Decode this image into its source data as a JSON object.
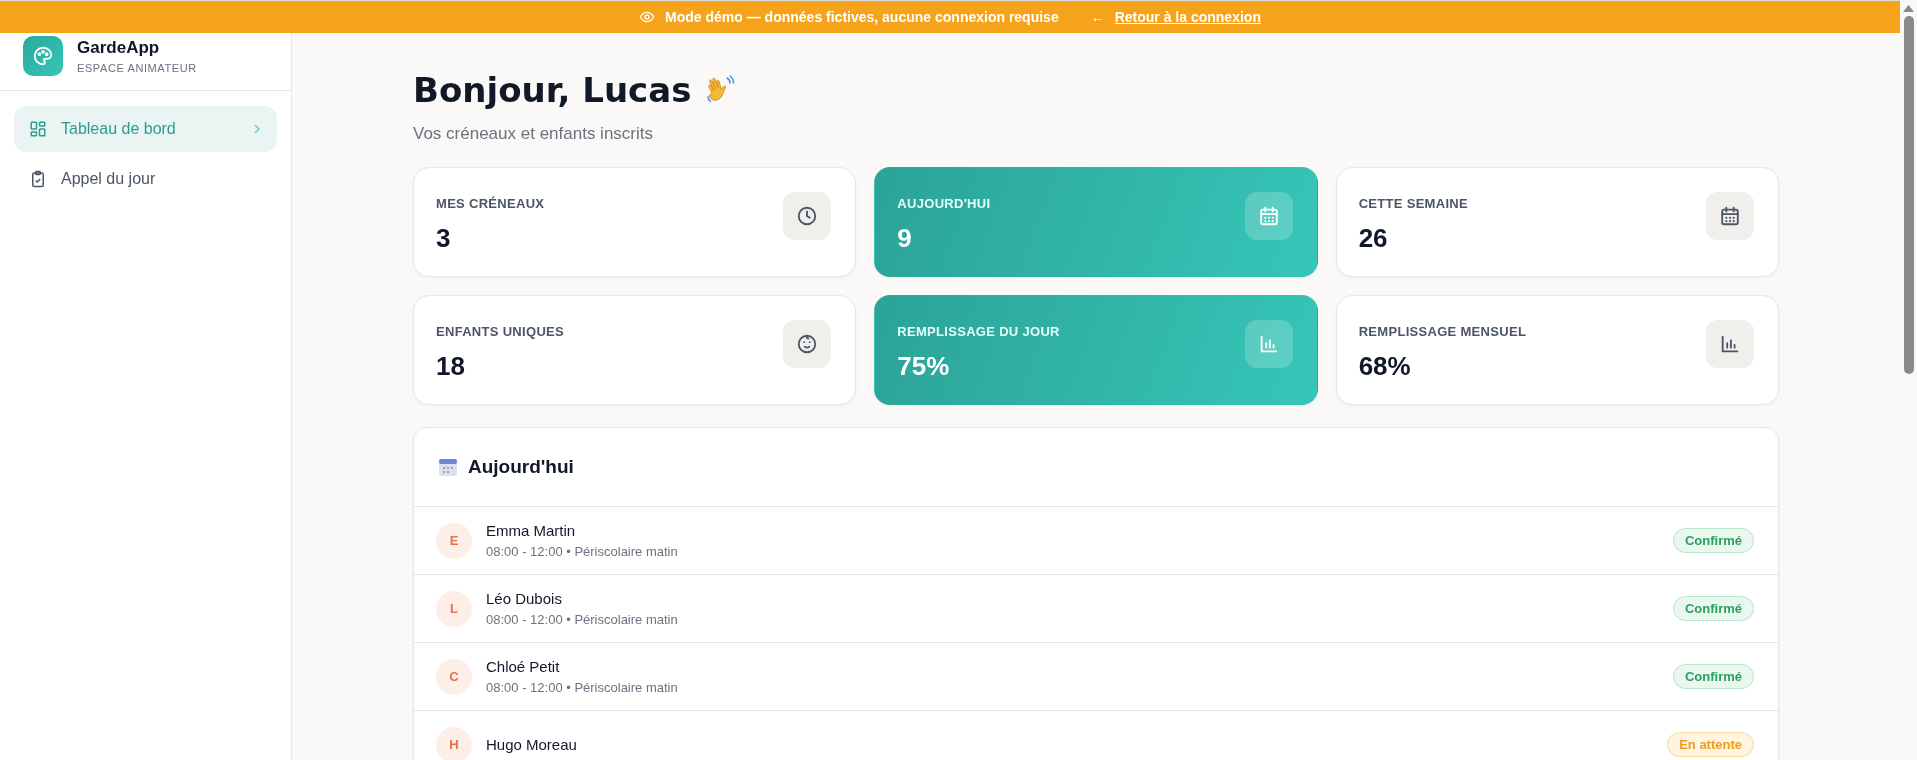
{
  "banner": {
    "message": "Mode démo — données fictives, aucune connexion requise",
    "arrow": "←",
    "link": "Retour à la connexion"
  },
  "sidebar": {
    "app_name": "GardeApp",
    "subtitle": "ESPACE ANIMATEUR",
    "items": [
      {
        "label": "Tableau de bord",
        "selected": true
      },
      {
        "label": "Appel du jour",
        "selected": false
      }
    ]
  },
  "header": {
    "title": "Bonjour, Lucas",
    "subtitle": "Vos créneaux et enfants inscrits"
  },
  "stats": [
    {
      "label": "MES CRÉNEAUX",
      "value": "3",
      "highlighted": false
    },
    {
      "label": "AUJOURD'HUI",
      "value": "9",
      "highlighted": true
    },
    {
      "label": "CETTE SEMAINE",
      "value": "26",
      "highlighted": false
    },
    {
      "label": "ENFANTS UNIQUES",
      "value": "18",
      "highlighted": false
    },
    {
      "label": "REMPLISSAGE DU JOUR",
      "value": "75%",
      "highlighted": true
    },
    {
      "label": "REMPLISSAGE MENSUEL",
      "value": "68%",
      "highlighted": false
    }
  ],
  "today": {
    "title": "Aujourd'hui",
    "rows": [
      {
        "initial": "E",
        "name": "Emma Martin",
        "details": "08:00 - 12:00 • Périscolaire matin",
        "status": "Confirmé",
        "kind": "confirmed"
      },
      {
        "initial": "L",
        "name": "Léo Dubois",
        "details": "08:00 - 12:00 • Périscolaire matin",
        "status": "Confirmé",
        "kind": "confirmed"
      },
      {
        "initial": "C",
        "name": "Chloé Petit",
        "details": "08:00 - 12:00 • Périscolaire matin",
        "status": "Confirmé",
        "kind": "confirmed"
      },
      {
        "initial": "H",
        "name": "Hugo Moreau",
        "status": "En attente",
        "kind": "pending"
      }
    ]
  }
}
